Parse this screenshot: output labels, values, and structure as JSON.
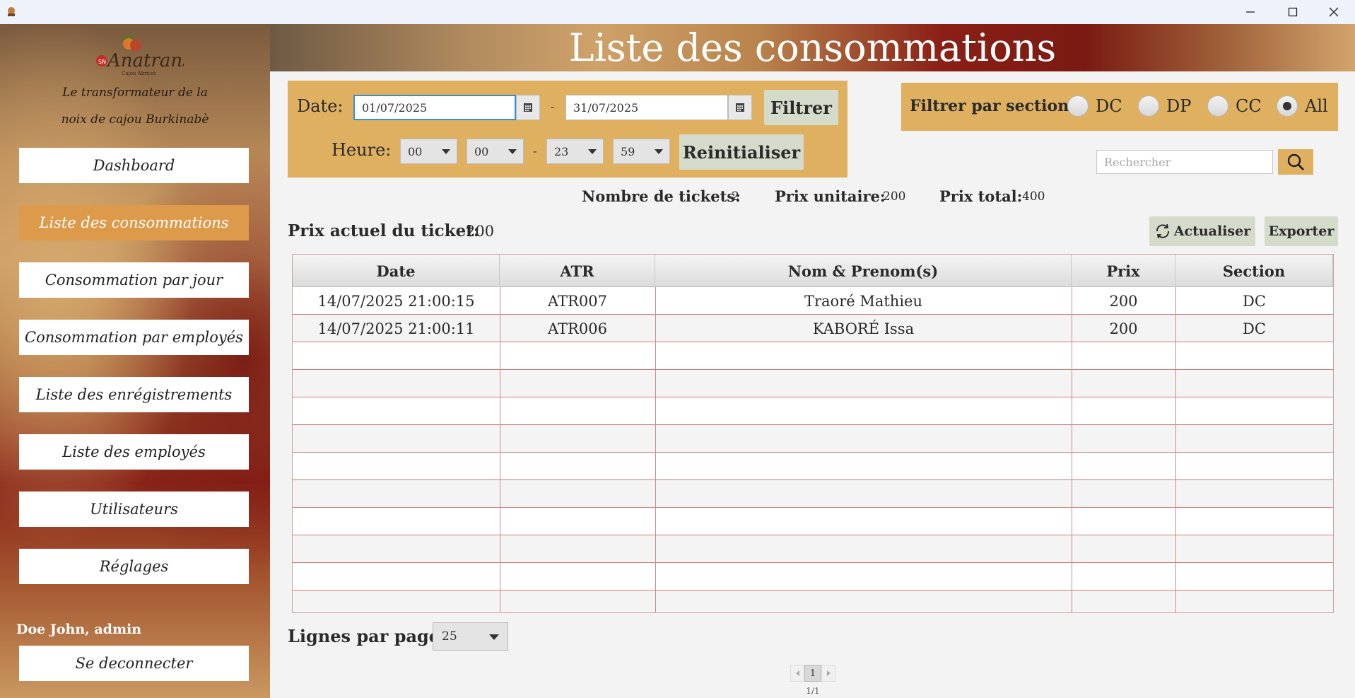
{
  "window": {
    "title": ""
  },
  "sidebar": {
    "brand": "Anatrans",
    "brand_sub": "Cajou Abricot",
    "tagline_1": "Le transformateur de la",
    "tagline_2": "noix de cajou Burkinabè",
    "items": [
      {
        "label": "Dashboard",
        "active": false
      },
      {
        "label": "Liste des consommations",
        "active": true
      },
      {
        "label": "Consommation par jour",
        "active": false
      },
      {
        "label": "Consommation par employés",
        "active": false
      },
      {
        "label": "Liste des enrégistrements",
        "active": false
      },
      {
        "label": "Liste des employés",
        "active": false
      },
      {
        "label": "Utilisateurs",
        "active": false
      },
      {
        "label": "Réglages",
        "active": false
      }
    ],
    "user": "Doe John, admin",
    "logout": "Se deconnecter"
  },
  "header": {
    "title": "Liste des consommations"
  },
  "filters": {
    "date_label": "Date:",
    "date_from": "01/07/2025",
    "date_sep": "-",
    "date_to": "31/07/2025",
    "filter_button": "Filtrer",
    "hour_label": "Heure:",
    "hour_from_h": "00",
    "hour_from_m": "00",
    "hour_sep": "-",
    "hour_to_h": "23",
    "hour_to_m": "59",
    "reset_button": "Reinitialiser"
  },
  "section_filter": {
    "label": "Filtrer par section:",
    "options": [
      "DC",
      "DP",
      "CC",
      "All"
    ],
    "selected": "All"
  },
  "search": {
    "placeholder": "Rechercher"
  },
  "stats": {
    "tickets_label": "Nombre de tickets:",
    "tickets_value": "2",
    "unit_price_label": "Prix unitaire:",
    "unit_price_value": "200",
    "total_label": "Prix total:",
    "total_value": "400"
  },
  "ticket_price": {
    "label": "Prix actuel du ticket:",
    "value": "200"
  },
  "toolbar": {
    "refresh": "Actualiser",
    "export": "Exporter"
  },
  "table": {
    "columns": [
      "Date",
      "ATR",
      "Nom & Prenom(s)",
      "Prix",
      "Section"
    ],
    "rows": [
      [
        "14/07/2025 21:00:15",
        "ATR007",
        "Traoré Mathieu",
        "200",
        "DC"
      ],
      [
        "14/07/2025 21:00:11",
        "ATR006",
        "KABORÉ Issa",
        "200",
        "DC"
      ]
    ]
  },
  "footer": {
    "rows_label": "Lignes par pages",
    "rows_value": "25",
    "current_page": "1",
    "page_info": "1/1"
  },
  "colors": {
    "accent": "#deb05f",
    "active_nav": "#de9a4b",
    "button": "#d5dbcb",
    "row_border": "#d47a7a"
  }
}
